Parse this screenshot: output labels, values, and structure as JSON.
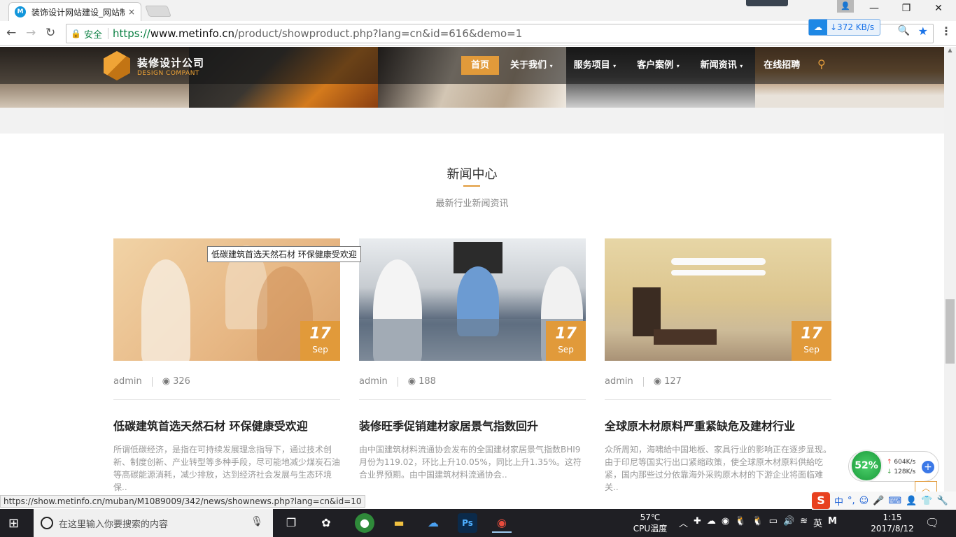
{
  "browser": {
    "tab_title": "装饰设计网站建设_网站制",
    "tab_favicon": "M",
    "tab_close": "×",
    "profile_icon": "person-icon",
    "secure_label": "安全",
    "url_scheme": "https://",
    "url_host": "www.metinfo.cn",
    "url_path": "/product/showproduct.php?lang=cn&id=616&demo=1",
    "speed_text": "↓372 KB/s",
    "speed_cloud": "☁"
  },
  "site": {
    "logo_title": "装修设计公司",
    "logo_sub": "DESIGN COMPANT",
    "nav": [
      {
        "label": "首页"
      },
      {
        "label": "关于我们"
      },
      {
        "label": "服务项目"
      },
      {
        "label": "客户案例"
      },
      {
        "label": "新闻资讯"
      },
      {
        "label": "在线招聘"
      }
    ],
    "caret": "▾",
    "search_glyph": "⚲"
  },
  "section": {
    "title": "新闻中心",
    "subtitle": "最新行业新闻资讯"
  },
  "cards": [
    {
      "day": "17",
      "month": "Sep",
      "author": "admin",
      "views": "326",
      "title": "低碳建筑首选天然石材 环保健康受欢迎",
      "desc": "所谓低碳经济，是指在可持续发展理念指导下，通过技术创新、制度创新、产业转型等多种手段，尽可能地减少煤炭石油等高碳能源消耗，减少排放，达到经济社会发展与生态环境保.."
    },
    {
      "day": "17",
      "month": "Sep",
      "author": "admin",
      "views": "188",
      "title": "装修旺季促销建材家居景气指数回升",
      "desc": "由中国建筑材料流通协会发布的全国建材家居景气指数BHI9月份为119.02，环比上升10.05%，同比上升1.35%。这符合业界预期。由中国建筑材料流通协会.."
    },
    {
      "day": "17",
      "month": "Sep",
      "author": "admin",
      "views": "127",
      "title": "全球原木材原料严重紧缺危及建材行业",
      "desc": "众所周知，海啸給中国地板、家具行业的影响正在逐步显现。由于印尼等国实行出口紧缩政策，使全球原木材原料供給吃紧，国内那些过分依靠海外采购原木材的下游企业将面临难关.."
    }
  ],
  "tooltip": "低碳建筑首选天然石材 环保健康受欢迎",
  "status_url": "https://show.metinfo.cn/muban/M1089009/342/news/shownews.php?lang=cn&id=10",
  "net_widget": {
    "percent": "52%",
    "up": "604K/s",
    "down": "128K/s"
  },
  "ime": {
    "logo": "S",
    "lang": "中"
  },
  "taskbar": {
    "search_placeholder": "在这里输入你要搜索的内容",
    "temp": "57℃",
    "temp_label": "CPU温度",
    "ime_lang": "英",
    "time": "1:15",
    "date": "2017/8/12"
  },
  "colors": {
    "accent": "#e19a3a",
    "secure_green": "#0b8043"
  }
}
